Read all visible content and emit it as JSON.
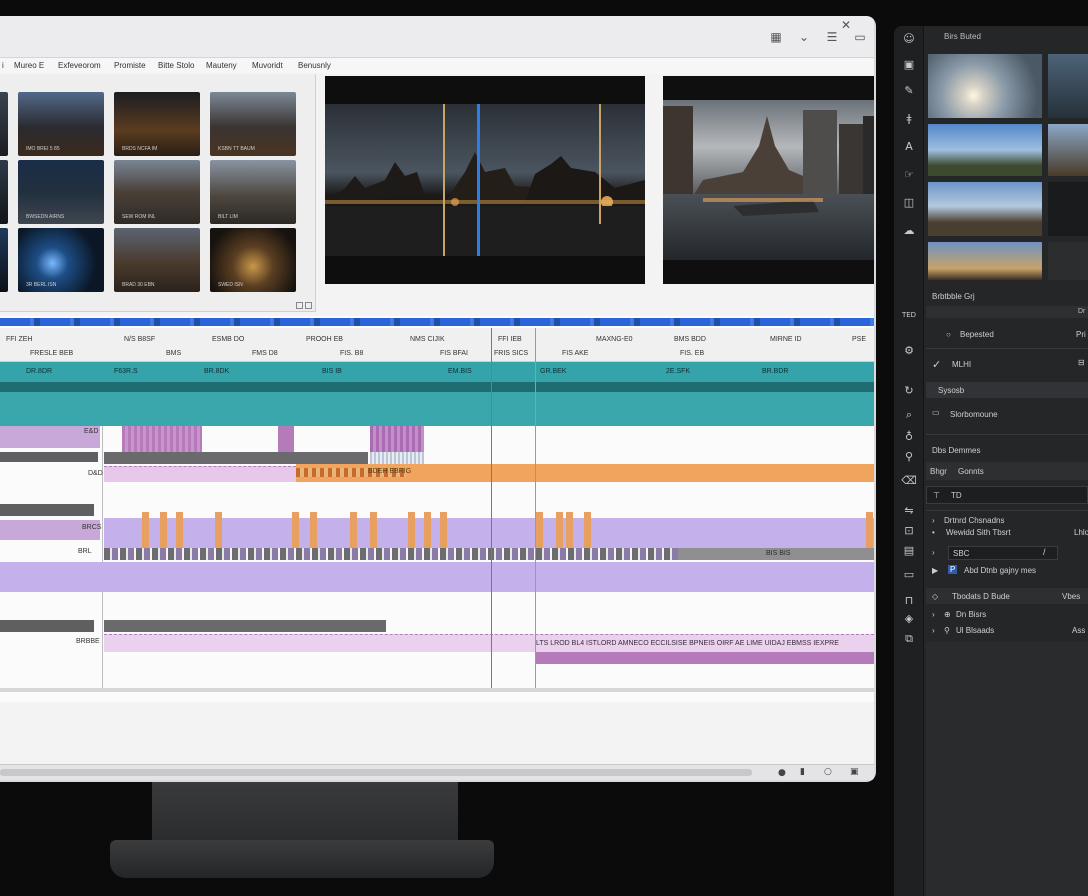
{
  "menu": [
    "Mureo E",
    "Exfeveorom",
    "Promiste",
    "Bitte Stolo",
    "Mauteny",
    "Muvoridt",
    "Benusnly"
  ],
  "thumbnails": [
    {
      "caption": "IMO BREI 5 85"
    },
    {
      "caption": "BRDS NCFA IM"
    },
    {
      "caption": "KSBN TT BAUM"
    },
    {
      "caption": "BWSEDN AIRNS"
    },
    {
      "caption": "SEW ROM INL"
    },
    {
      "caption": "BILT LIM"
    },
    {
      "caption": "3R BERL ISN"
    },
    {
      "caption": "BRAD 30 EBN"
    },
    {
      "caption": "SWED ISN"
    }
  ],
  "timeline": {
    "ruler": [
      "FFI ZEH",
      "N/S B8SF",
      "ESMB DO",
      "PROOH EB",
      "NMS CIJIK",
      "FFI IEB",
      "MAXNG-E0",
      "BMS BDD",
      "MIRNE ID",
      "PSE"
    ],
    "ruler2": [
      "FRESLE BEB",
      "BMS",
      "FMS D8",
      "FIS. B8",
      "FIS BFAI",
      "FRIS SICS",
      "FIS AKE",
      "FIS. EB"
    ],
    "teal_labels": [
      "DR.8DR",
      "F63R.S",
      "BR.8DK",
      "BIS IB",
      "EM.BIS",
      "GR.BEK",
      "2E.SFK",
      "BR.BDR"
    ],
    "track_labels": [
      "E&D",
      "D&D",
      "BRCS",
      "BRL",
      "BRBBE"
    ],
    "clip_label": "BDEH EBRIG",
    "bottom_text": "LTS LROD BL4 ISTLORD AMNECO ECCILSISE BPNEIS OIRF AE LIME UIDAJ EBMSS IEXPRE",
    "mini_label": "BIS BIS"
  },
  "right_panel": {
    "title": "Birs Buted",
    "row1": "Brbtbble Grj",
    "row1_right": "Dr",
    "row2": "Bepested",
    "row2_right": "Pri",
    "row3": "MLHI",
    "row4": "Sysosb",
    "row5": "Slorbomoune",
    "section": "Dbs Demmes",
    "row6_a": "Bhgr",
    "row6_b": "Gonnts",
    "row7": "TD",
    "row8": "Drtnrd Chsnadns",
    "row9": "Wewidd Sith Tbsrt",
    "row9_right": "Lhlo",
    "row10": "SBC",
    "row11": "Abd Dtnb gajny mes",
    "row12": "Tbodats D Bude",
    "row12_right": "Vbes",
    "row13": "Dn Bisrs",
    "row14": "Ul Blsaads",
    "row14_right": "Ass"
  }
}
